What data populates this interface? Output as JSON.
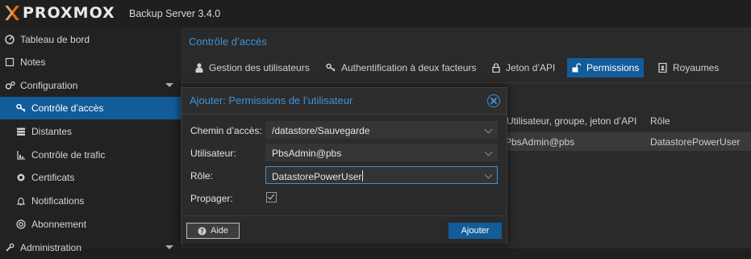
{
  "app": {
    "brand": "PROXMOX",
    "version": "Backup Server 3.4.0"
  },
  "sidebar": {
    "items": [
      {
        "label": "Tableau de bord"
      },
      {
        "label": "Notes"
      },
      {
        "label": "Configuration"
      },
      {
        "label": "Contrôle d’accès"
      },
      {
        "label": "Distantes"
      },
      {
        "label": "Contrôle de trafic"
      },
      {
        "label": "Certificats"
      },
      {
        "label": "Notifications"
      },
      {
        "label": "Abonnement"
      },
      {
        "label": "Administration"
      }
    ]
  },
  "main": {
    "title": "Contrôle d’accès",
    "tabs": [
      {
        "label": "Gestion des utilisateurs"
      },
      {
        "label": "Authentification à deux facteurs"
      },
      {
        "label": "Jeton d’API"
      },
      {
        "label": "Permissions"
      },
      {
        "label": "Royaumes"
      }
    ],
    "grid": {
      "headers": [
        "Utilisateur, groupe, jeton d’API",
        "Rôle"
      ],
      "rows": [
        [
          "PbsAdmin@pbs",
          "DatastorePowerUser"
        ]
      ]
    }
  },
  "dialog": {
    "title": "Ajouter: Permissions de l’utilisateur",
    "path_label": "Chemin d’accès:",
    "path_value": "/datastore/Sauvegarde",
    "user_label": "Utilisateur:",
    "user_value": "PbsAdmin@pbs",
    "role_label": "Rôle:",
    "role_value": "DatastorePowerUser",
    "propagate_label": "Propager:",
    "propagate_checked": true,
    "help_button": "Aide",
    "add_button": "Ajouter"
  },
  "colors": {
    "accent": "#135c9a",
    "title_blue": "#3d92d6",
    "logo_orange": "#e57000"
  }
}
